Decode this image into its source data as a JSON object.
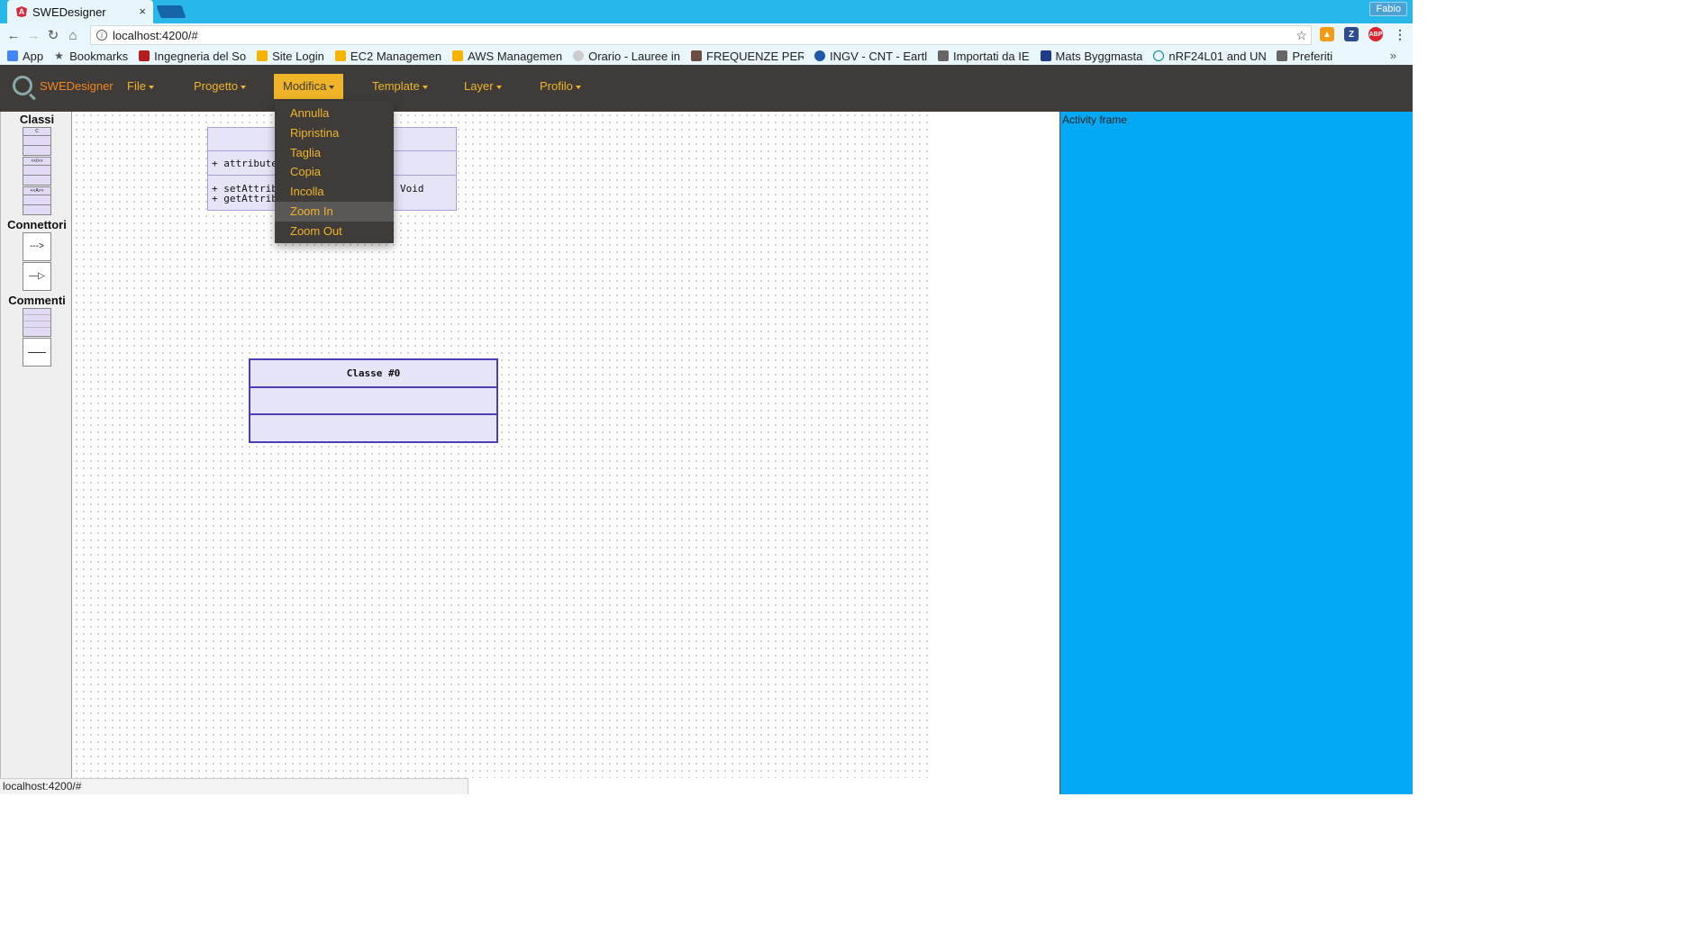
{
  "browser": {
    "tab_title": "SWEDesigner",
    "tab_close": "×",
    "user": "Fabio",
    "url": "localhost:4200/#",
    "bookmarks": [
      "App",
      "Bookmarks",
      "Ingegneria del So",
      "Site Login",
      "EC2 Managemen",
      "AWS Managemen",
      "Orario - Lauree in",
      "FREQUENZE PER",
      "INGV - CNT - Eartl",
      "Importati da IE",
      "Mats Byggmasta",
      "nRF24L01 and UN",
      "Preferiti"
    ],
    "bookmarks_more": "»",
    "status_url": "localhost:4200/#"
  },
  "app": {
    "brand": "SWEDesigner",
    "menus": [
      "File",
      "Progetto",
      "Modifica",
      "Template",
      "Layer",
      "Profilo"
    ],
    "active_menu": "Modifica",
    "dropdown_items": [
      "Annulla",
      "Ripristina",
      "Taglia",
      "Copia",
      "Incolla",
      "Zoom In",
      "Zoom Out"
    ],
    "hovered_item": "Zoom In"
  },
  "palette": {
    "classes_title": "Classi",
    "class_tiles": [
      "C",
      "<<I>>",
      "<<A>>"
    ],
    "connectors_title": "Connettori",
    "connector_tiles": [
      "--->",
      "—▷"
    ],
    "comments_title": "Commenti"
  },
  "canvas": {
    "class_top": {
      "attribute": "+ attribute",
      "method1": "+ setAttrib",
      "method2": "+ getAttrib",
      "return_type": "Void"
    },
    "class0": {
      "title": "Classe #0"
    }
  },
  "activity_frame": {
    "label": "Activity frame",
    "color": "#03a9f4"
  },
  "colors": {
    "navbar": "#3e3b38",
    "accent": "#f0b429",
    "brand": "#f5851f",
    "uml_fill": "#e6e4f7",
    "uml_border": "#4a3fb5"
  }
}
